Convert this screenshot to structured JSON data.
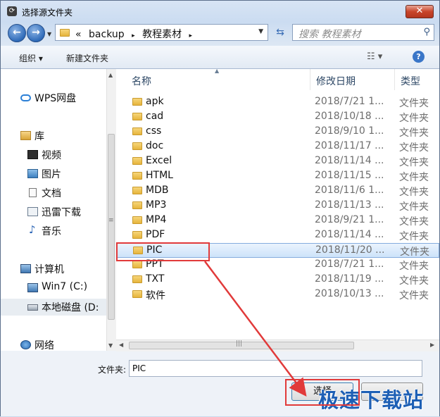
{
  "window": {
    "title": "选择源文件夹",
    "close_label": "✕"
  },
  "nav": {
    "back_icon": "back-arrow-icon",
    "forward_icon": "forward-arrow-icon",
    "breadcrumb": [
      "«",
      "backup",
      "▸",
      "教程素材",
      "▸"
    ],
    "search_placeholder": "搜索 教程素材"
  },
  "toolbar": {
    "organize_label": "组织 ▾",
    "new_folder_label": "新建文件夹"
  },
  "sidebar": {
    "items": [
      {
        "label": "WPS网盘"
      },
      {
        "label": "库"
      },
      {
        "label": "视频"
      },
      {
        "label": "图片"
      },
      {
        "label": "文档"
      },
      {
        "label": "迅雷下载"
      },
      {
        "label": "音乐"
      },
      {
        "label": "计算机"
      },
      {
        "label": "Win7 (C:)"
      },
      {
        "label": "本地磁盘 (D:"
      },
      {
        "label": "网络"
      }
    ]
  },
  "columns": {
    "name": "名称",
    "date": "修改日期",
    "type": "类型"
  },
  "files": [
    {
      "name": "apk",
      "date": "2018/7/21 1...",
      "type": "文件夹"
    },
    {
      "name": "cad",
      "date": "2018/10/18 ...",
      "type": "文件夹"
    },
    {
      "name": "css",
      "date": "2018/9/10 1...",
      "type": "文件夹"
    },
    {
      "name": "doc",
      "date": "2018/11/17 ...",
      "type": "文件夹"
    },
    {
      "name": "Excel",
      "date": "2018/11/14 ...",
      "type": "文件夹"
    },
    {
      "name": "HTML",
      "date": "2018/11/15 ...",
      "type": "文件夹"
    },
    {
      "name": "MDB",
      "date": "2018/11/6 1...",
      "type": "文件夹"
    },
    {
      "name": "MP3",
      "date": "2018/11/13 ...",
      "type": "文件夹"
    },
    {
      "name": "MP4",
      "date": "2018/9/21 1...",
      "type": "文件夹"
    },
    {
      "name": "PDF",
      "date": "2018/11/14 ...",
      "type": "文件夹"
    },
    {
      "name": "PIC",
      "date": "2018/11/20 ...",
      "type": "文件夹"
    },
    {
      "name": "PPT",
      "date": "2018/7/21 1...",
      "type": "文件夹"
    },
    {
      "name": "TXT",
      "date": "2018/11/19 ...",
      "type": "文件夹"
    },
    {
      "name": "软件",
      "date": "2018/10/13 ...",
      "type": "文件夹"
    }
  ],
  "selected_index": 10,
  "bottom": {
    "folder_label": "文件夹:",
    "folder_value": "PIC",
    "select_label": "选择",
    "cancel_label": ""
  },
  "watermark": "极速下载站",
  "colors": {
    "highlight": "#e13a3a",
    "accent": "#3a76c8"
  }
}
